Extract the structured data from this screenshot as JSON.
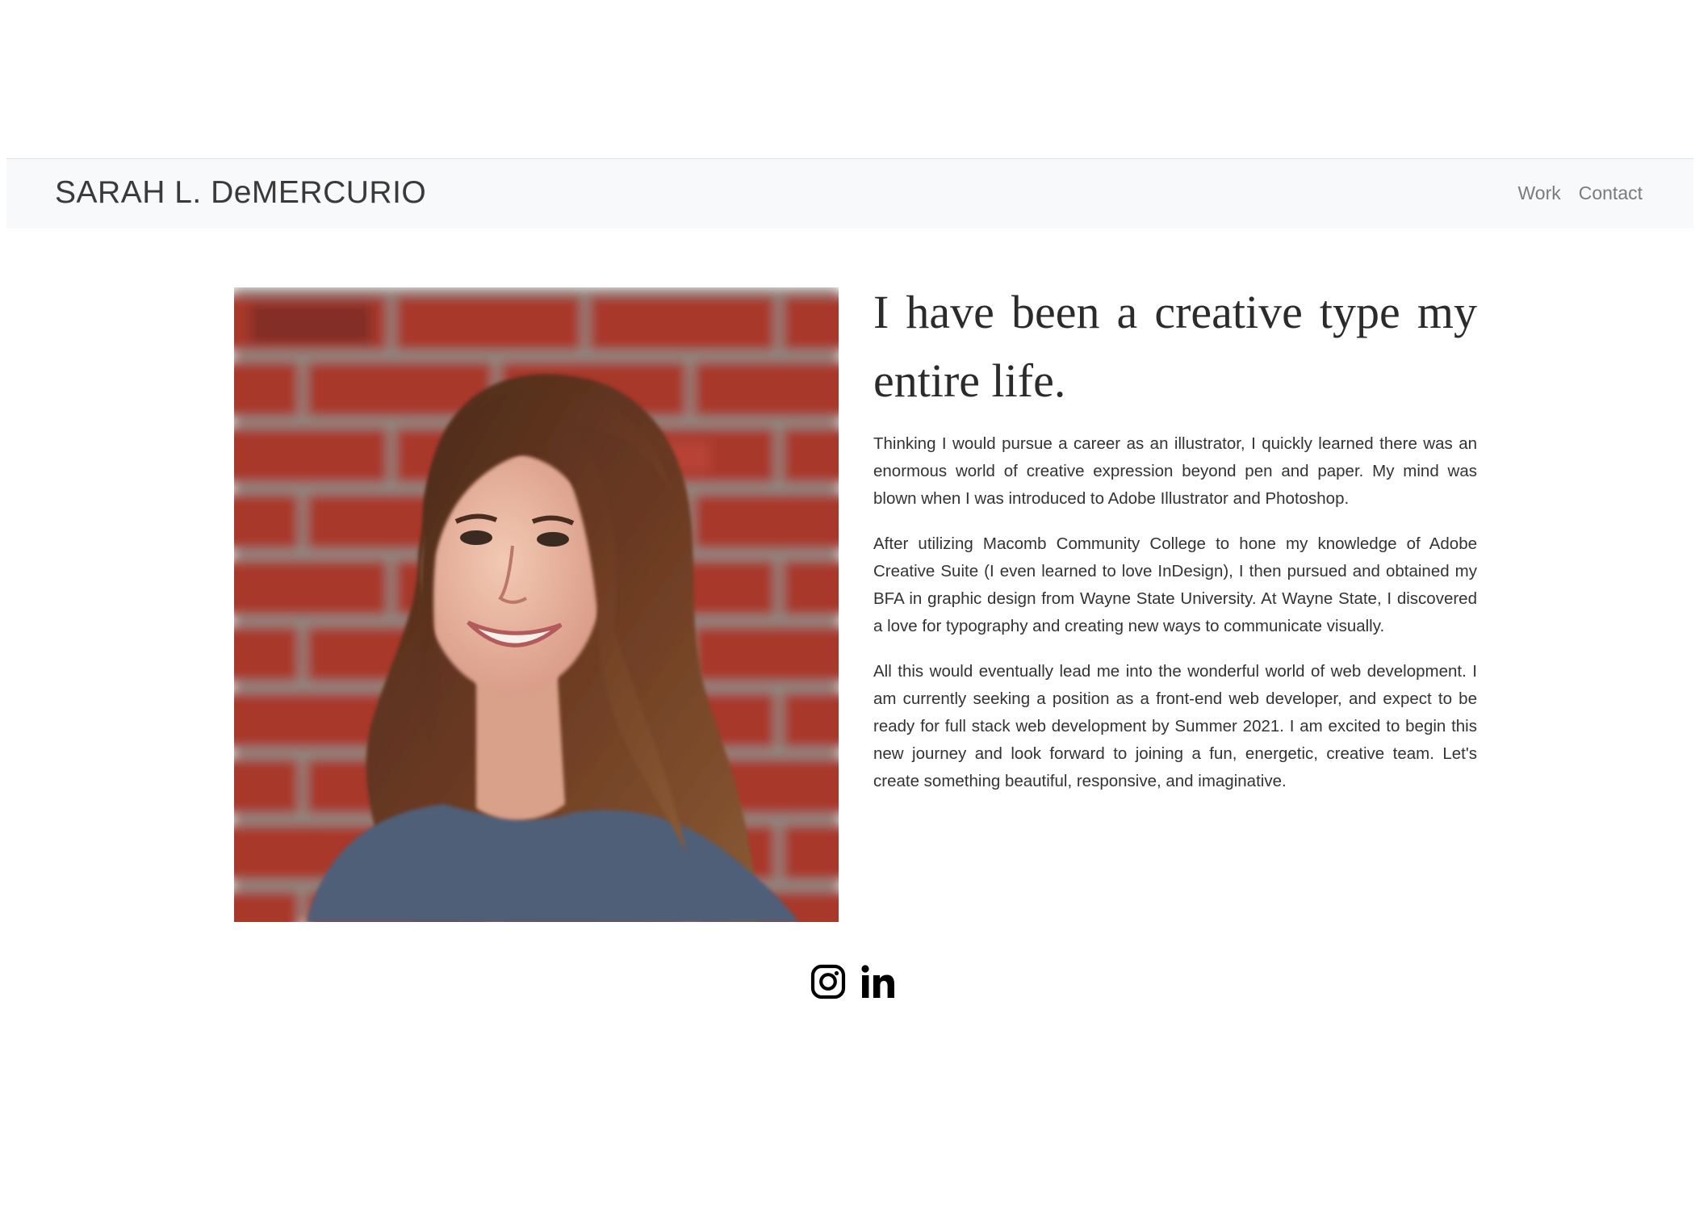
{
  "navbar": {
    "brand": "SARAH L. DeMERCURIO",
    "links": [
      {
        "label": "Work"
      },
      {
        "label": "Contact"
      }
    ]
  },
  "about": {
    "headline": "I have been a creative type my entire life.",
    "paragraphs": [
      "Thinking I would pursue a career as an illustrator, I quickly learned there was an enormous world of creative expression beyond pen and paper. My mind was blown when I was introduced to Adobe Illustrator and Photoshop.",
      "After utilizing Macomb Community College to hone my knowledge of Adobe Creative Suite (I even learned to love InDesign), I then pursued and obtained my BFA in graphic design from Wayne State University. At Wayne State, I discovered a love for typography and creating new ways to communicate visually.",
      "All this would eventually lead me into the wonderful world of web development. I am currently seeking a position as a front-end web developer, and expect to be ready for full stack web development by Summer 2021. I am excited to begin this new journey and look forward to joining a fun, energetic, creative team. Let's create something beautiful, responsive, and imaginative."
    ]
  },
  "social": {
    "icons": [
      "instagram-icon",
      "linkedin-icon"
    ]
  },
  "colors": {
    "navbar_bg": "#f8f9fa",
    "brick": "#a33a2e",
    "mortar": "#9a948c"
  }
}
